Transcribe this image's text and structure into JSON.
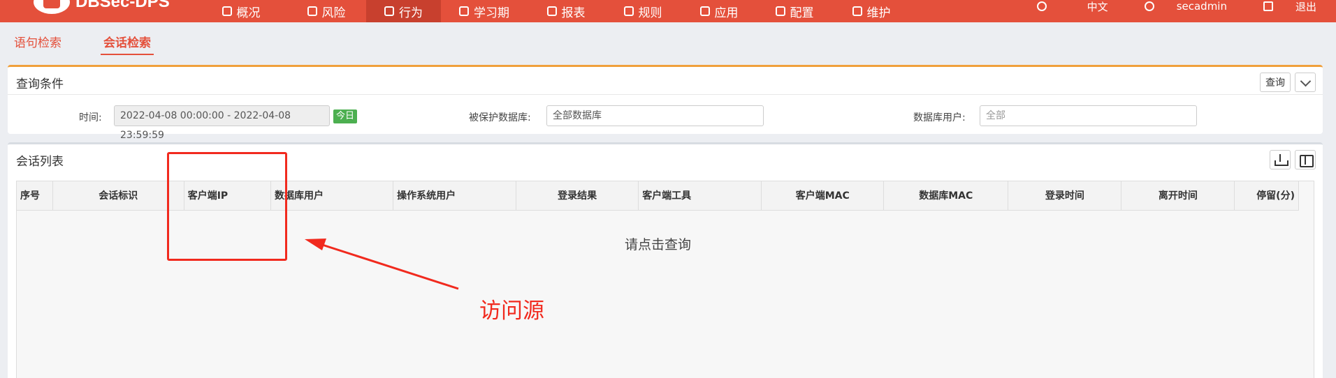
{
  "app": {
    "logo_text": "DBSec-DPS"
  },
  "nav": {
    "items": [
      {
        "label": "概况",
        "icon": "dashboard-icon"
      },
      {
        "label": "风险",
        "icon": "risk-icon"
      },
      {
        "label": "行为",
        "icon": "behavior-icon",
        "active": true
      },
      {
        "label": "学习期",
        "icon": "learning-icon"
      },
      {
        "label": "报表",
        "icon": "report-icon"
      },
      {
        "label": "规则",
        "icon": "rule-icon"
      },
      {
        "label": "应用",
        "icon": "app-icon"
      },
      {
        "label": "配置",
        "icon": "config-icon"
      },
      {
        "label": "维护",
        "icon": "maintenance-icon"
      }
    ],
    "language": "中文",
    "user": "secadmin",
    "logout": "退出"
  },
  "tabs": {
    "statement": "语句检索",
    "session": "会话检索"
  },
  "query": {
    "title": "查询条件",
    "query_button": "查询",
    "time_label": "时间:",
    "time_value": "2022-04-08 00:00:00 - 2022-04-08 23:59:59",
    "today_badge": "今日",
    "db_label": "被保护数据库:",
    "db_value": "全部数据库",
    "user_label": "数据库用户:",
    "user_placeholder": "全部"
  },
  "session_list": {
    "title": "会话列表",
    "columns": [
      "序号",
      "会话标识",
      "客户端IP",
      "数据库用户",
      "操作系统用户",
      "登录结果",
      "客户端工具",
      "客户端MAC",
      "数据库MAC",
      "登录时间",
      "离开时间",
      "停留(分)"
    ],
    "empty_message": "请点击查询"
  },
  "annotation": {
    "label": "访问源",
    "color": "#f12a1e"
  },
  "colors": {
    "brand": "#e4503b",
    "nav_active": "#c8402e",
    "panel_accent": "#f0a03c",
    "today_badge": "#4caf50"
  }
}
